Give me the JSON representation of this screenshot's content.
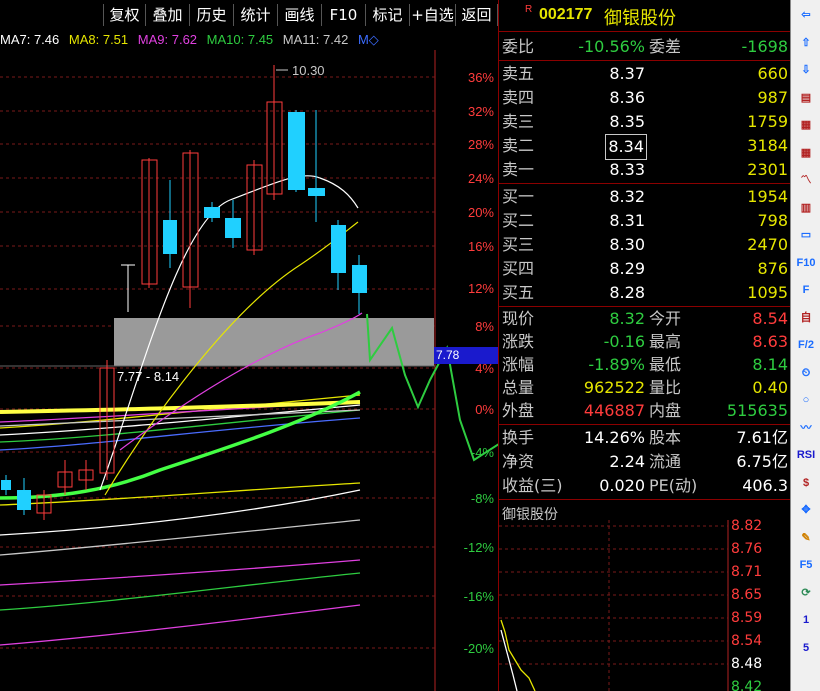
{
  "toolbar": {
    "buttons": [
      "复权",
      "叠加",
      "历史",
      "统计",
      "画线",
      "F10",
      "标记",
      "+自选",
      "返回"
    ]
  },
  "ma_legend": [
    {
      "label": "MA7: 7.46",
      "color": "#ffffff"
    },
    {
      "label": "MA8: 7.51",
      "color": "#e6e600"
    },
    {
      "label": "MA9: 7.62",
      "color": "#e040e0"
    },
    {
      "label": "MA10: 7.45",
      "color": "#2ecc40"
    },
    {
      "label": "MA11: 7.42",
      "color": "#c8c8c8"
    },
    {
      "label": "M◇",
      "color": "#3c6cff"
    }
  ],
  "chart": {
    "pct_labels": [
      "36%",
      "32%",
      "28%",
      "24%",
      "20%",
      "16%",
      "12%",
      "8%",
      "4%",
      "0%",
      "-4%",
      "-8%",
      "-12%",
      "-16%",
      "-20%"
    ],
    "high_label": "10.30",
    "range_label": "7.77 - 8.14",
    "cursor_price": "7.78"
  },
  "stock": {
    "marker": "R",
    "code": "002177",
    "name": "御银股份"
  },
  "summary": {
    "weibi_label": "委比",
    "weibi": "-10.56%",
    "weicha_label": "委差",
    "weicha": "-1698"
  },
  "asks": [
    {
      "label": "卖五",
      "price": "8.37",
      "vol": "660"
    },
    {
      "label": "卖四",
      "price": "8.36",
      "vol": "987"
    },
    {
      "label": "卖三",
      "price": "8.35",
      "vol": "1759"
    },
    {
      "label": "卖二",
      "price": "8.34",
      "vol": "3184"
    },
    {
      "label": "卖一",
      "price": "8.33",
      "vol": "2301"
    }
  ],
  "bids": [
    {
      "label": "买一",
      "price": "8.32",
      "vol": "1954"
    },
    {
      "label": "买二",
      "price": "8.31",
      "vol": "798"
    },
    {
      "label": "买三",
      "price": "8.30",
      "vol": "2470"
    },
    {
      "label": "买四",
      "price": "8.29",
      "vol": "876"
    },
    {
      "label": "买五",
      "price": "8.28",
      "vol": "1095"
    }
  ],
  "quote": [
    {
      "l1": "现价",
      "v1": "8.32",
      "c1": "green",
      "l2": "今开",
      "v2": "8.54",
      "c2": "red"
    },
    {
      "l1": "涨跌",
      "v1": "-0.16",
      "c1": "green",
      "l2": "最高",
      "v2": "8.63",
      "c2": "red"
    },
    {
      "l1": "涨幅",
      "v1": "-1.89%",
      "c1": "green",
      "l2": "最低",
      "v2": "8.14",
      "c2": "green"
    },
    {
      "l1": "总量",
      "v1": "962522",
      "c1": "yellow",
      "l2": "量比",
      "v2": "0.40",
      "c2": "yellow"
    },
    {
      "l1": "外盘",
      "v1": "446887",
      "c1": "red",
      "l2": "内盘",
      "v2": "515635",
      "c2": "green"
    }
  ],
  "finance": [
    {
      "l1": "换手",
      "v1": "14.26%",
      "l2": "股本",
      "v2": "7.61亿"
    },
    {
      "l1": "净资",
      "v1": "2.24",
      "l2": "流通",
      "v2": "6.75亿"
    },
    {
      "l1": "收益(三)",
      "v1": "0.020",
      "l2": "PE(动)",
      "v2": "406.3"
    }
  ],
  "mini_chart": {
    "title": "御银股份",
    "prices": [
      "8.82",
      "8.76",
      "8.71",
      "8.65",
      "8.59",
      "8.54",
      "8.48",
      "8.42"
    ]
  },
  "sidebar": {
    "icons": [
      "arrow-left-icon",
      "arrow-up-icon",
      "arrow-down-icon",
      "list-icon",
      "grid-icon",
      "grid2-icon",
      "line-chart-icon",
      "candle-chart-icon",
      "window-icon",
      "f10-icon",
      "f10b-icon",
      "self-icon",
      "fz-icon",
      "timer-icon",
      "circle-icon",
      "wave-icon",
      "rsi-icon",
      "dollar-icon",
      "move-icon",
      "pen-icon",
      "f5-icon",
      "refresh-icon",
      "one-icon",
      "five-icon"
    ],
    "labels": [
      "⇦",
      "⇧",
      "⇩",
      "▤",
      "▦",
      "▦",
      "〽",
      "▥",
      "▭",
      "F10",
      "F",
      "自",
      "F/2",
      "⏲",
      "○",
      "〰",
      "RSI",
      "$",
      "✥",
      "✎",
      "F5",
      "⟳",
      "1",
      "5"
    ]
  }
}
